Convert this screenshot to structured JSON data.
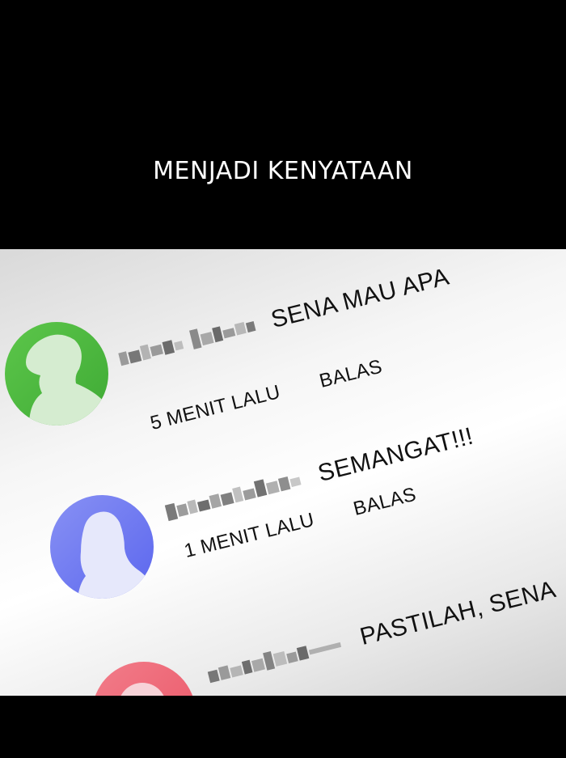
{
  "caption": "MENJADI KENYATAAN",
  "comments": [
    {
      "text": "SENA MAU APA",
      "time": "5 MENIT LALU",
      "reply_label": "BALAS",
      "avatar_color": "#4fba3f",
      "avatar_icon": "person-silhouette-icon"
    },
    {
      "text": "SEMANGAT!!!",
      "time": "1 MENIT LALU",
      "reply_label": "BALAS",
      "avatar_color": "#6f79f0",
      "avatar_icon": "person-silhouette-icon"
    },
    {
      "text": "PASTILAH, SENA",
      "avatar_color": "#f06a7a",
      "avatar_icon": "person-silhouette-icon"
    }
  ]
}
